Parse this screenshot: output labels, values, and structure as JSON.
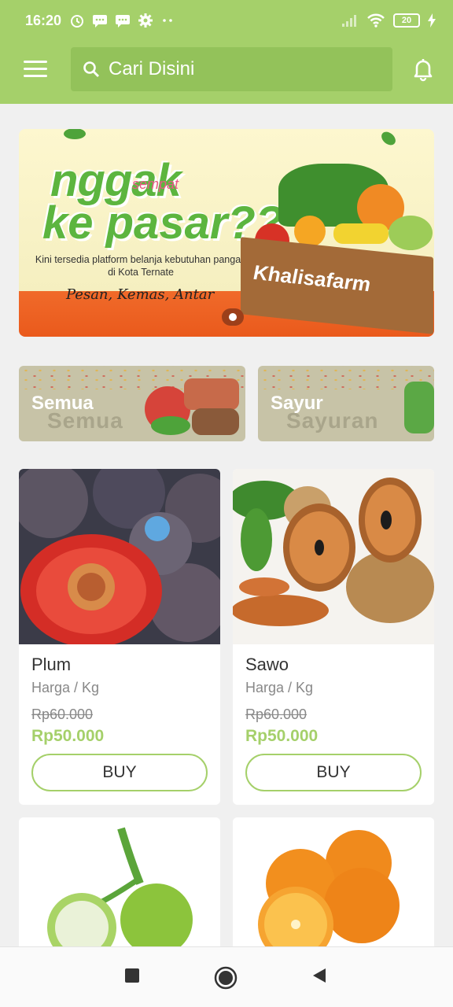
{
  "status_bar": {
    "time": "16:20",
    "battery": "20"
  },
  "header": {
    "search_placeholder": "Cari Disini"
  },
  "banner": {
    "headline_1": "nggak",
    "headline_small": "sempat",
    "headline_2": "ke pasar??",
    "description": "Kini tersedia platform belanja kebutuhan pangan di Kota Ternate",
    "tagline": "Pesan, Kemas, Antar",
    "brand": "Khalisafarm"
  },
  "categories": [
    {
      "label": "Semua",
      "shadow": "Semua"
    },
    {
      "label": "Sayur",
      "shadow": "Sayuran"
    }
  ],
  "products": [
    {
      "name": "Plum",
      "unit": "Harga / Kg",
      "old_price": "Rp60.000",
      "price": "Rp50.000",
      "button": "BUY"
    },
    {
      "name": "Sawo",
      "unit": "Harga / Kg",
      "old_price": "Rp60.000",
      "price": "Rp50.000",
      "button": "BUY"
    }
  ],
  "colors": {
    "accent": "#a5d06a",
    "search_bg": "#93c25a",
    "banner_orange": "#f06a2a"
  }
}
